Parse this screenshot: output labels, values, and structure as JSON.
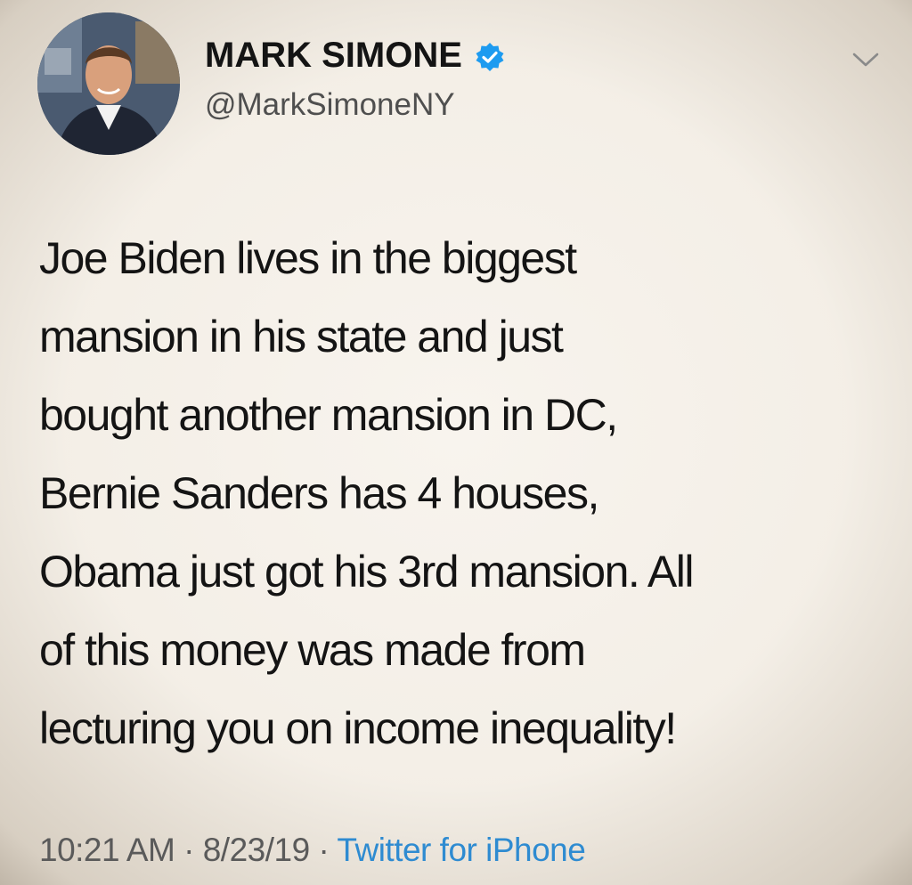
{
  "user": {
    "display_name": "MARK SIMONE",
    "handle": "@MarkSimoneNY",
    "verified": true,
    "verified_color": "#1d9bf0"
  },
  "tweet": {
    "lines": [
      "Joe Biden lives in the biggest",
      "mansion in his state and just",
      "bought another mansion in DC,",
      "Bernie Sanders has 4 houses,",
      "Obama just got his 3rd mansion. All",
      "of this money was made from",
      "lecturing you on income inequality!"
    ]
  },
  "meta": {
    "time": "10:21 AM",
    "separator": "·",
    "date": "8/23/19",
    "source": "Twitter for iPhone",
    "source_color": "#2e8bd1"
  },
  "icons": {
    "verified": "verified-badge-icon",
    "menu": "chevron-down-icon"
  }
}
